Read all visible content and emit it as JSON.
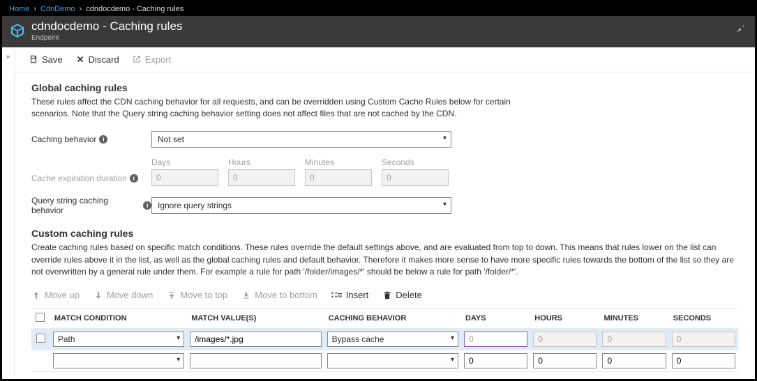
{
  "breadcrumb": {
    "home": "Home",
    "profile": "CdnDemo",
    "current": "cdndocdemo - Caching rules"
  },
  "header": {
    "title": "cdndocdemo - Caching rules",
    "subtitle": "Endpoint"
  },
  "toolbar": {
    "save": "Save",
    "discard": "Discard",
    "export": "Export"
  },
  "global": {
    "heading": "Global caching rules",
    "description": "These rules affect the CDN caching behavior for all requests, and can be overridden using Custom Cache Rules below for certain scenarios. Note that the Query string caching behavior setting does not affect files that are not cached by the CDN.",
    "caching_behavior_label": "Caching behavior",
    "caching_behavior_value": "Not set",
    "expiration_label": "Cache expiration duration",
    "duration_labels": {
      "days": "Days",
      "hours": "Hours",
      "minutes": "Minutes",
      "seconds": "Seconds"
    },
    "duration_values": {
      "days": "0",
      "hours": "0",
      "minutes": "0",
      "seconds": "0"
    },
    "query_label": "Query string caching behavior",
    "query_value": "Ignore query strings"
  },
  "custom": {
    "heading": "Custom caching rules",
    "description": "Create caching rules based on specific match conditions. These rules override the default settings above, and are evaluated from top to down. This means that rules lower on the list can override rules above it in the list, as well as the global caching rules and default behavior. Therefore it makes more sense to have more specific rules towards the bottom of the list so they are not overwritten by a general rule under them. For example a rule for path '/folder/images/*' should be below a rule for path '/folder/*'.",
    "toolbar": {
      "move_up": "Move up",
      "move_down": "Move down",
      "move_top": "Move to top",
      "move_bottom": "Move to bottom",
      "insert": "Insert",
      "delete": "Delete"
    },
    "columns": {
      "match_condition": "MATCH CONDITION",
      "match_values": "MATCH VALUE(S)",
      "caching_behavior": "CACHING BEHAVIOR",
      "days": "DAYS",
      "hours": "HOURS",
      "minutes": "MINUTES",
      "seconds": "SECONDS"
    },
    "rows": [
      {
        "match_condition": "Path",
        "match_value": "/images/*.jpg",
        "caching_behavior": "Bypass cache",
        "days": "0",
        "hours": "0",
        "minutes": "0",
        "seconds": "0",
        "selected": true,
        "duration_disabled": true
      },
      {
        "match_condition": "",
        "match_value": "",
        "caching_behavior": "",
        "days": "0",
        "hours": "0",
        "minutes": "0",
        "seconds": "0",
        "selected": false,
        "duration_disabled": false
      }
    ]
  }
}
